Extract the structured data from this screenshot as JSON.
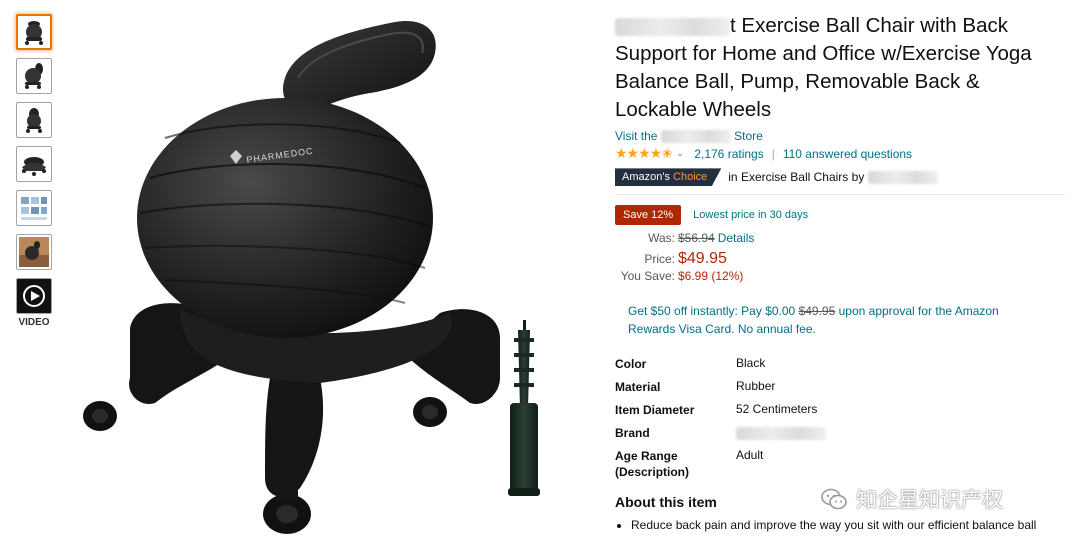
{
  "thumbnails": [
    {
      "name": "thumb-chair-front",
      "selected": true
    },
    {
      "name": "thumb-chair-side"
    },
    {
      "name": "thumb-chair-back"
    },
    {
      "name": "thumb-chair-base"
    },
    {
      "name": "thumb-chair-infographic"
    },
    {
      "name": "thumb-chair-lifestyle"
    }
  ],
  "video": {
    "label": "VIDEO",
    "icon": "play-icon"
  },
  "main_image": {
    "ball_brand_text": "PHARMEDOC"
  },
  "product": {
    "title_suffix": "t Exercise Ball Chair with Back Support for Home and Office w/Exercise Yoga Balance Ball, Pump, Removable Back & Lockable Wheels",
    "store_prefix": "Visit the",
    "store_suffix": "Store",
    "stars": "★★★★✬",
    "ratings": "2,176 ratings",
    "answered": "110 answered questions",
    "choice_label_1": "Amazon's",
    "choice_label_2": "Choice",
    "choice_text": "in Exercise Ball Chairs by"
  },
  "deal": {
    "save_badge": "Save 12%",
    "lowest": "Lowest price in 30 days"
  },
  "pricing": {
    "was_label": "Was:",
    "was_value": "$56.94",
    "details": "Details",
    "price_label": "Price:",
    "price_value": "$49.95",
    "save_label": "You Save:",
    "save_value": "$6.99 (12%)"
  },
  "promo": {
    "text_1": "Get $50 off instantly: Pay $0.00",
    "strike": "$49.95",
    "text_2": "upon approval for the Amazon Rewards Visa Card. No annual fee."
  },
  "attributes": [
    {
      "key": "Color",
      "value": "Black"
    },
    {
      "key": "Material",
      "value": "Rubber"
    },
    {
      "key": "Item Diameter",
      "value": "52 Centimeters"
    },
    {
      "key": "Brand",
      "value": ""
    },
    {
      "key": "Age Range (Description)",
      "value": "Adult"
    }
  ],
  "about": {
    "title": "About this item",
    "bullets": [
      "Reduce back pain and improve the way you sit with our efficient balance ball"
    ]
  },
  "watermark": {
    "text": "知企星知识产权"
  },
  "colors": {
    "link": "#007185",
    "price": "#b12704",
    "star": "#ffa41c",
    "choice_bg": "#232f3e",
    "choice_accent": "#f69931",
    "selected_thumb": "#e77600"
  }
}
